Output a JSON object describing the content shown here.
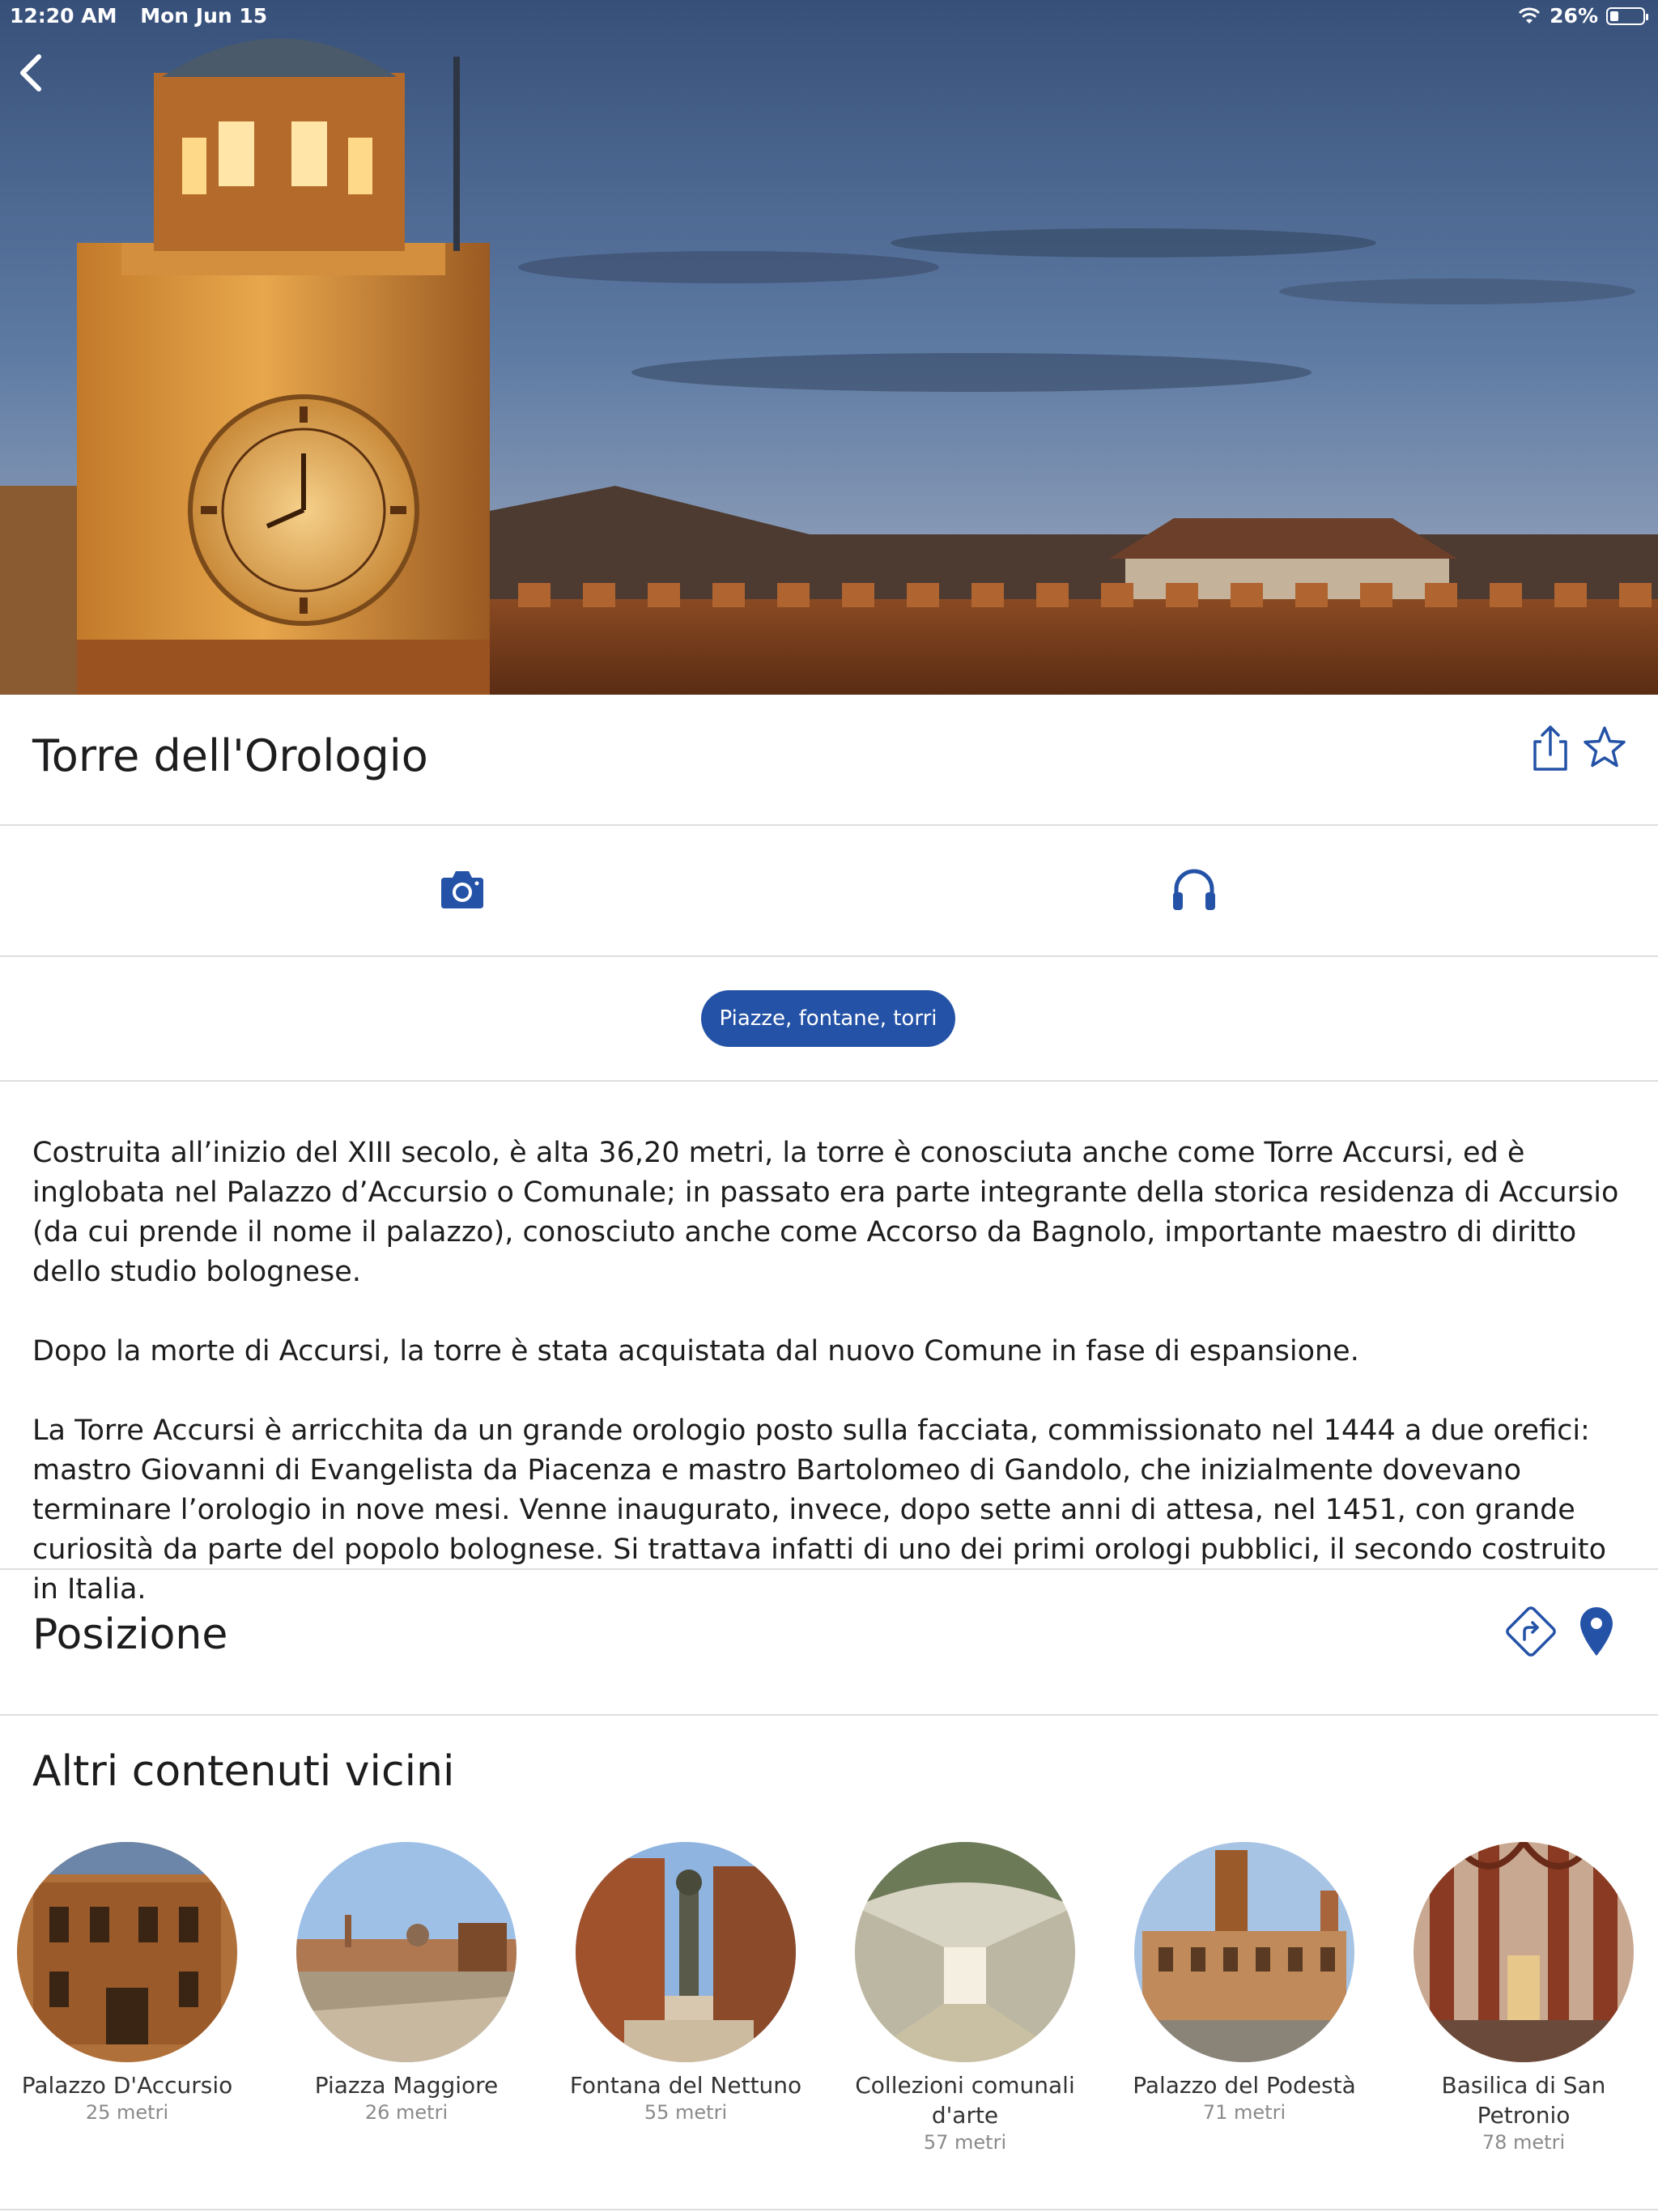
{
  "status_bar": {
    "time": "12:20 AM",
    "date": "Mon Jun 15",
    "battery": "26%",
    "battery_level": 0.26
  },
  "title": "Torre dell'Orologio",
  "category_tag": "Piazze, fontane, torri",
  "description": [
    "Costruita all’inizio del XIII secolo, è alta 36,20 metri, la torre è conosciuta anche come Torre Accursi, ed è inglobata nel Palazzo d’Accursio o Comunale; in passato era parte integrante della storica residenza di Accursio (da cui prende il nome il palazzo), conosciuto anche come Accorso da Bagnolo, importante maestro di diritto dello studio bolognese.",
    "Dopo la morte di Accursi, la torre è stata acquistata dal nuovo Comune in fase di espansione.",
    "La Torre Accursi è arricchita da un grande orologio posto sulla facciata, commissionato nel 1444 a due orefici: mastro Giovanni di Evangelista da Piacenza e mastro Bartolomeo di Gandolo, che inizialmente dovevano terminare l’orologio in nove mesi. Venne inaugurato, invece, dopo sette anni di attesa, nel 1451, con grande curiosità da parte del popolo bolognese. Si trattava infatti di uno dei primi orologi pubblici, il secondo costruito in Italia."
  ],
  "position_title": "Posizione",
  "nearby_title": "Altri contenuti vicini",
  "nearby": [
    {
      "name": "Palazzo D'Accursio",
      "distance": "25 metri"
    },
    {
      "name": "Piazza Maggiore",
      "distance": "26 metri"
    },
    {
      "name": "Fontana del Nettuno",
      "distance": "55 metri"
    },
    {
      "name": "Collezioni comunali d'arte",
      "distance": "57 metri"
    },
    {
      "name": "Palazzo del Podestà",
      "distance": "71 metri"
    },
    {
      "name": "Basilica di San Petronio",
      "distance": "78 metri"
    }
  ],
  "colors": {
    "accent": "#2452a6",
    "divider": "#dedede"
  },
  "icons": [
    "back-chevron-icon",
    "share-icon",
    "star-icon",
    "camera-icon",
    "headphones-icon",
    "directions-icon",
    "map-pin-icon"
  ]
}
